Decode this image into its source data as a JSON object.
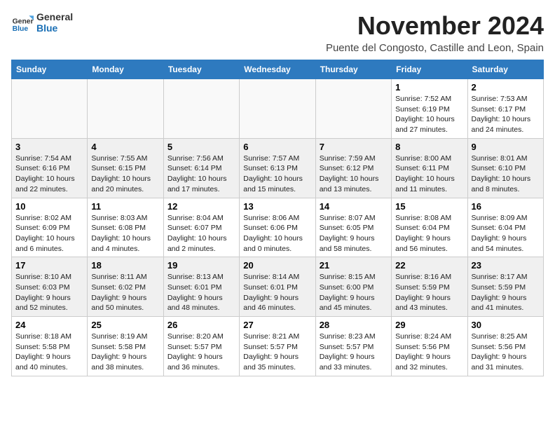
{
  "logo": {
    "general": "General",
    "blue": "Blue"
  },
  "title": "November 2024",
  "location": "Puente del Congosto, Castille and Leon, Spain",
  "days_header": [
    "Sunday",
    "Monday",
    "Tuesday",
    "Wednesday",
    "Thursday",
    "Friday",
    "Saturday"
  ],
  "weeks": [
    [
      {
        "day": "",
        "info": ""
      },
      {
        "day": "",
        "info": ""
      },
      {
        "day": "",
        "info": ""
      },
      {
        "day": "",
        "info": ""
      },
      {
        "day": "",
        "info": ""
      },
      {
        "day": "1",
        "info": "Sunrise: 7:52 AM\nSunset: 6:19 PM\nDaylight: 10 hours and 27 minutes."
      },
      {
        "day": "2",
        "info": "Sunrise: 7:53 AM\nSunset: 6:17 PM\nDaylight: 10 hours and 24 minutes."
      }
    ],
    [
      {
        "day": "3",
        "info": "Sunrise: 7:54 AM\nSunset: 6:16 PM\nDaylight: 10 hours and 22 minutes."
      },
      {
        "day": "4",
        "info": "Sunrise: 7:55 AM\nSunset: 6:15 PM\nDaylight: 10 hours and 20 minutes."
      },
      {
        "day": "5",
        "info": "Sunrise: 7:56 AM\nSunset: 6:14 PM\nDaylight: 10 hours and 17 minutes."
      },
      {
        "day": "6",
        "info": "Sunrise: 7:57 AM\nSunset: 6:13 PM\nDaylight: 10 hours and 15 minutes."
      },
      {
        "day": "7",
        "info": "Sunrise: 7:59 AM\nSunset: 6:12 PM\nDaylight: 10 hours and 13 minutes."
      },
      {
        "day": "8",
        "info": "Sunrise: 8:00 AM\nSunset: 6:11 PM\nDaylight: 10 hours and 11 minutes."
      },
      {
        "day": "9",
        "info": "Sunrise: 8:01 AM\nSunset: 6:10 PM\nDaylight: 10 hours and 8 minutes."
      }
    ],
    [
      {
        "day": "10",
        "info": "Sunrise: 8:02 AM\nSunset: 6:09 PM\nDaylight: 10 hours and 6 minutes."
      },
      {
        "day": "11",
        "info": "Sunrise: 8:03 AM\nSunset: 6:08 PM\nDaylight: 10 hours and 4 minutes."
      },
      {
        "day": "12",
        "info": "Sunrise: 8:04 AM\nSunset: 6:07 PM\nDaylight: 10 hours and 2 minutes."
      },
      {
        "day": "13",
        "info": "Sunrise: 8:06 AM\nSunset: 6:06 PM\nDaylight: 10 hours and 0 minutes."
      },
      {
        "day": "14",
        "info": "Sunrise: 8:07 AM\nSunset: 6:05 PM\nDaylight: 9 hours and 58 minutes."
      },
      {
        "day": "15",
        "info": "Sunrise: 8:08 AM\nSunset: 6:04 PM\nDaylight: 9 hours and 56 minutes."
      },
      {
        "day": "16",
        "info": "Sunrise: 8:09 AM\nSunset: 6:04 PM\nDaylight: 9 hours and 54 minutes."
      }
    ],
    [
      {
        "day": "17",
        "info": "Sunrise: 8:10 AM\nSunset: 6:03 PM\nDaylight: 9 hours and 52 minutes."
      },
      {
        "day": "18",
        "info": "Sunrise: 8:11 AM\nSunset: 6:02 PM\nDaylight: 9 hours and 50 minutes."
      },
      {
        "day": "19",
        "info": "Sunrise: 8:13 AM\nSunset: 6:01 PM\nDaylight: 9 hours and 48 minutes."
      },
      {
        "day": "20",
        "info": "Sunrise: 8:14 AM\nSunset: 6:01 PM\nDaylight: 9 hours and 46 minutes."
      },
      {
        "day": "21",
        "info": "Sunrise: 8:15 AM\nSunset: 6:00 PM\nDaylight: 9 hours and 45 minutes."
      },
      {
        "day": "22",
        "info": "Sunrise: 8:16 AM\nSunset: 5:59 PM\nDaylight: 9 hours and 43 minutes."
      },
      {
        "day": "23",
        "info": "Sunrise: 8:17 AM\nSunset: 5:59 PM\nDaylight: 9 hours and 41 minutes."
      }
    ],
    [
      {
        "day": "24",
        "info": "Sunrise: 8:18 AM\nSunset: 5:58 PM\nDaylight: 9 hours and 40 minutes."
      },
      {
        "day": "25",
        "info": "Sunrise: 8:19 AM\nSunset: 5:58 PM\nDaylight: 9 hours and 38 minutes."
      },
      {
        "day": "26",
        "info": "Sunrise: 8:20 AM\nSunset: 5:57 PM\nDaylight: 9 hours and 36 minutes."
      },
      {
        "day": "27",
        "info": "Sunrise: 8:21 AM\nSunset: 5:57 PM\nDaylight: 9 hours and 35 minutes."
      },
      {
        "day": "28",
        "info": "Sunrise: 8:23 AM\nSunset: 5:57 PM\nDaylight: 9 hours and 33 minutes."
      },
      {
        "day": "29",
        "info": "Sunrise: 8:24 AM\nSunset: 5:56 PM\nDaylight: 9 hours and 32 minutes."
      },
      {
        "day": "30",
        "info": "Sunrise: 8:25 AM\nSunset: 5:56 PM\nDaylight: 9 hours and 31 minutes."
      }
    ]
  ]
}
